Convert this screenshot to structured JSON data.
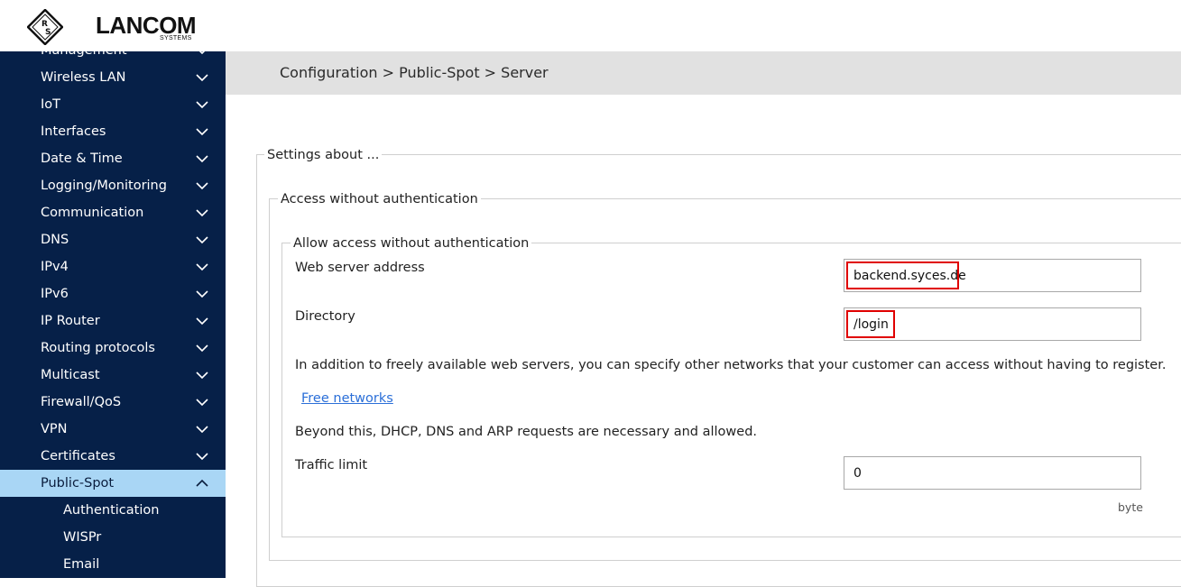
{
  "brand": {
    "name": "LANCOM",
    "sub": "SYSTEMS",
    "logo_letters": "R&S"
  },
  "sidebar": {
    "items": [
      {
        "label": "Management"
      },
      {
        "label": "Wireless LAN"
      },
      {
        "label": "IoT"
      },
      {
        "label": "Interfaces"
      },
      {
        "label": "Date & Time"
      },
      {
        "label": "Logging/Monitoring"
      },
      {
        "label": "Communication"
      },
      {
        "label": "DNS"
      },
      {
        "label": "IPv4"
      },
      {
        "label": "IPv6"
      },
      {
        "label": "IP Router"
      },
      {
        "label": "Routing protocols"
      },
      {
        "label": "Multicast"
      },
      {
        "label": "Firewall/QoS"
      },
      {
        "label": "VPN"
      },
      {
        "label": "Certificates"
      },
      {
        "label": "Public-Spot",
        "expanded": true
      }
    ],
    "subitems": [
      {
        "label": "Authentication"
      },
      {
        "label": "WISPr"
      },
      {
        "label": "Email"
      }
    ],
    "colors": {
      "background": "#062048",
      "active": "#a9d6f5"
    }
  },
  "breadcrumb": "Configuration > Public-Spot > Server",
  "settings": {
    "legend": "Settings about ...",
    "access_group": {
      "legend": "Access without authentication",
      "allow_group": {
        "legend": "Allow access without authentication",
        "web_server_label": "Web server address",
        "web_server_value": "backend.syces.de",
        "directory_label": "Directory",
        "directory_value": "/login",
        "info_text": "In addition to freely available web servers, you can specify other networks that your customer can access without having to register.",
        "free_networks_link": "Free networks",
        "note_text": "Beyond this, DHCP, DNS and ARP requests are necessary and allowed.",
        "traffic_label": "Traffic limit",
        "traffic_value": "0",
        "traffic_unit": "byte"
      }
    }
  },
  "highlight_color": "#e00000"
}
